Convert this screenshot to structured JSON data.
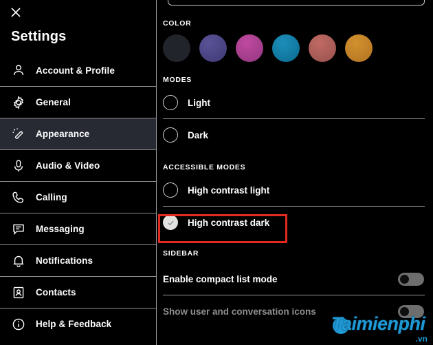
{
  "sidebar": {
    "close_icon": "close-icon",
    "title": "Settings",
    "items": [
      {
        "label": "Account & Profile",
        "icon": "person-icon",
        "active": false
      },
      {
        "label": "General",
        "icon": "gear-icon",
        "active": false
      },
      {
        "label": "Appearance",
        "icon": "magic-wand-icon",
        "active": true
      },
      {
        "label": "Audio & Video",
        "icon": "microphone-icon",
        "active": false
      },
      {
        "label": "Calling",
        "icon": "phone-icon",
        "active": false
      },
      {
        "label": "Messaging",
        "icon": "chat-bubble-icon",
        "active": false
      },
      {
        "label": "Notifications",
        "icon": "bell-icon",
        "active": false
      },
      {
        "label": "Contacts",
        "icon": "contact-card-icon",
        "active": false
      },
      {
        "label": "Help & Feedback",
        "icon": "info-circle-icon",
        "active": false
      }
    ]
  },
  "main": {
    "color_section": {
      "label": "COLOR",
      "swatches": [
        {
          "name": "dark-gray",
          "hex": "#21242b"
        },
        {
          "name": "indigo",
          "hex": "#4b4486"
        },
        {
          "name": "magenta",
          "hex": "#ab4091"
        },
        {
          "name": "teal-blue",
          "hex": "#0f7ba4"
        },
        {
          "name": "rose",
          "hex": "#ab5b57"
        },
        {
          "name": "orange",
          "hex": "#c3822c"
        }
      ]
    },
    "modes_section": {
      "label": "MODES",
      "options": [
        {
          "label": "Light",
          "selected": false
        },
        {
          "label": "Dark",
          "selected": false
        }
      ]
    },
    "accessible_modes_section": {
      "label": "ACCESSIBLE MODES",
      "options": [
        {
          "label": "High contrast light",
          "selected": false
        },
        {
          "label": "High contrast dark",
          "selected": true
        }
      ],
      "highlight_color": "#e02a1f"
    },
    "sidebar_section": {
      "label": "SIDEBAR",
      "rows": [
        {
          "label": "Enable compact list mode",
          "toggle": "off",
          "dim": false
        },
        {
          "label": "Show user and conversation icons",
          "toggle": "off",
          "dim": true
        }
      ]
    }
  },
  "watermark": {
    "text": "aimienphi",
    "initial": "T",
    "suffix": ".vn",
    "color": "#1f9ad6"
  }
}
